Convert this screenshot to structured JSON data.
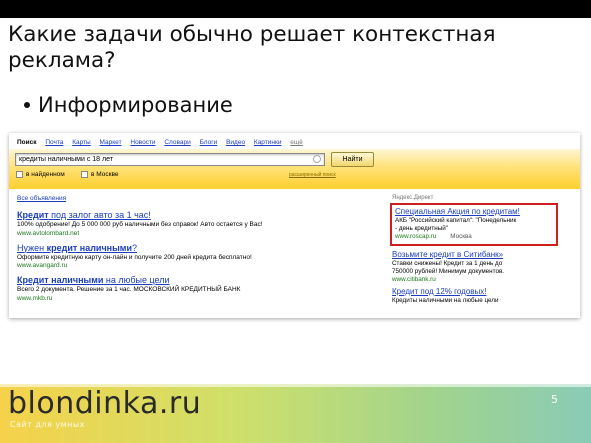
{
  "slide": {
    "title": "Какие задачи обычно решает контекстная реклама?",
    "bullet": "Информирование",
    "page_number": "5"
  },
  "browser": {
    "nav": [
      {
        "label": "Поиск",
        "active": true
      },
      {
        "label": "Почта"
      },
      {
        "label": "Карты"
      },
      {
        "label": "Маркет"
      },
      {
        "label": "Новости"
      },
      {
        "label": "Словари"
      },
      {
        "label": "Блоги"
      },
      {
        "label": "Видео"
      },
      {
        "label": "Картинки"
      },
      {
        "label": "ещё"
      }
    ],
    "search_value": "кредиты наличными с 18 лет",
    "find_label": "Найти",
    "checkbox_found": "в найденном",
    "checkbox_moscow": "в Москве",
    "advanced_link": "расширенный поиск",
    "all_ads": "Все объявления",
    "direct_label": "Яндекс.Директ"
  },
  "left_ads": [
    {
      "title_bold": "Кредит",
      "title_rest": " под залог авто за 1 час!",
      "text": "100% одобрение! До 5 000 000 руб наличными без справок! Авто остается у Вас!",
      "url": "www.avtolombard.net"
    },
    {
      "title_pre": "Нужен ",
      "title_bold": "кредит наличными",
      "title_rest": "?",
      "text": "Оформите кредитную карту он-лайн и получите 200 дней кредита бесплатно!",
      "url": "www.avangard.ru"
    },
    {
      "title_bold": "Кредит наличными",
      "title_rest": " на любые цели",
      "text": "Всего 2 документа. Решение за 1 час. МОСКОВСКИЙ КРЕДИТНЫЙ БАНК",
      "url": "www.mkb.ru"
    }
  ],
  "right_ads": [
    {
      "title": "Специальная Акция по кредитам!",
      "text1": "АКБ \"Российский капитал\": \"Понедельник",
      "text2": "- день кредитный\"",
      "url": "www.roscap.ru",
      "city": "Москва",
      "highlighted": true
    },
    {
      "title": "Возьмите кредит в Ситибанк»",
      "text1": "Ставки снижены! Кредит за 1 день до",
      "text2": "750000 рублей! Минимум документов.",
      "url": "www.citibank.ru"
    },
    {
      "title": "Кредит под 12% годовых!",
      "text1": "Кредиты наличными на любые цели",
      "text2": "",
      "url": ""
    }
  ],
  "footer": {
    "logo": "blondinka.ru",
    "subtitle": "Сайт для умных"
  },
  "colors": {
    "link": "#1a3dc1",
    "url_green": "#1b7a1b",
    "highlight_red": "#d01f1f",
    "yandex_yellow": "#ffcf2e"
  }
}
